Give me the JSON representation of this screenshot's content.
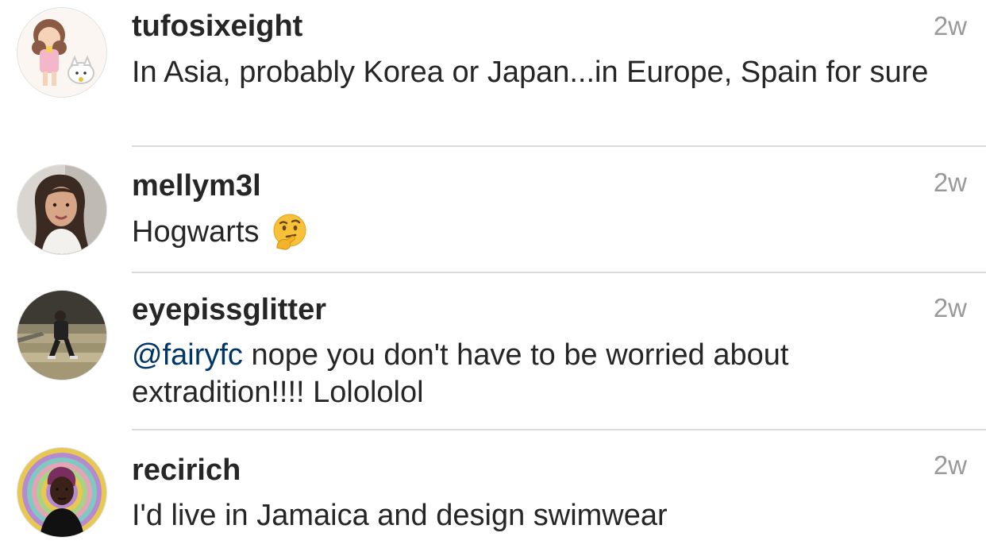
{
  "comments": [
    {
      "username": "tufosixeight",
      "time": "2w",
      "text": "In Asia, probably Korea or Japan...in Europe, Spain for sure",
      "avatar_icon": "cartoon-girl-with-cat-avatar"
    },
    {
      "username": "mellym3l",
      "time": "2w",
      "text": "Hogwarts",
      "emoji_icon": "thinking-face-emoji",
      "avatar_icon": "woman-portrait-avatar"
    },
    {
      "username": "eyepissglitter",
      "time": "2w",
      "mention": "@fairyfc",
      "text": " nope you don't have to be worried about extradition!!!! Lolololol",
      "avatar_icon": "person-sitting-on-steps-avatar"
    },
    {
      "username": "recirich",
      "time": "2w",
      "text": "I'd live in Jamaica and design swimwear",
      "avatar_icon": "person-with-rainbow-background-avatar"
    }
  ],
  "colors": {
    "username": "#262626",
    "text": "#262626",
    "timestamp": "#999999",
    "mention": "#003569",
    "divider": "#dbdbdb"
  }
}
